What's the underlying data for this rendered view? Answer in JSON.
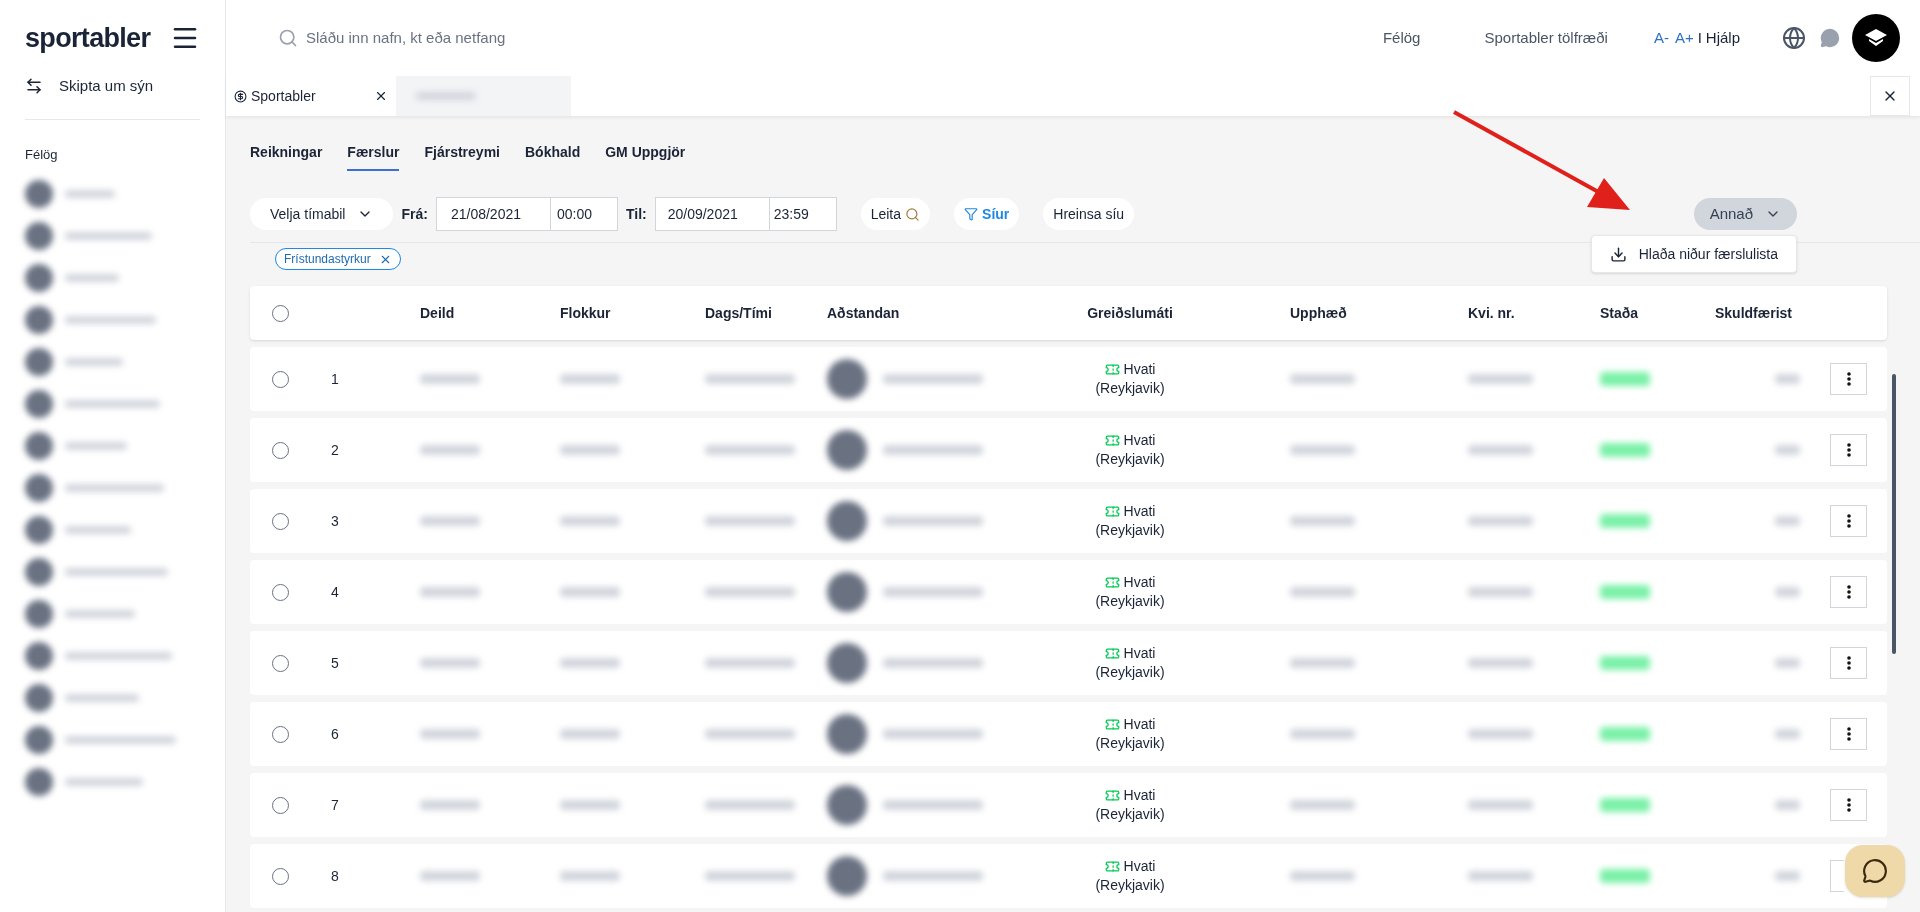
{
  "logo": "sportabler",
  "sidebar": {
    "switch_view": "Skipta um sýn",
    "section_title": "Félög"
  },
  "search": {
    "placeholder": "Sláðu inn nafn, kt eða netfang"
  },
  "top_nav": {
    "links": [
      "Félög",
      "Sportabler tölfræði"
    ],
    "font_smaller": "A-",
    "font_larger": "A+",
    "separator": "I",
    "help": "Hjálp"
  },
  "open_tabs": [
    {
      "label": "Sportabler",
      "selected": true
    }
  ],
  "sub_tabs": [
    {
      "label": "Reikningar",
      "selected": false
    },
    {
      "label": "Færslur",
      "selected": true
    },
    {
      "label": "Fjárstreymi",
      "selected": false
    },
    {
      "label": "Bókhald",
      "selected": false
    },
    {
      "label": "GM Uppgjör",
      "selected": false
    }
  ],
  "filters": {
    "period": "Velja tímabil",
    "from_label": "Frá:",
    "from_date": "21/08/2021",
    "from_time": "00:00",
    "to_label": "Til:",
    "to_date": "20/09/2021",
    "to_time": "23:59",
    "search": "Leita",
    "filters": "Síur",
    "clear": "Hreinsa síu"
  },
  "active_filters": [
    "Frístundastyrkur"
  ],
  "other_menu": {
    "label": "Annað",
    "expanded": true,
    "items": [
      "Hlaða niður færslulista"
    ]
  },
  "table": {
    "columns": [
      "Deild",
      "Flokkur",
      "Dags/Tími",
      "Aðstandan",
      "Greiðslumáti",
      "Upphæð",
      "Kvi. nr.",
      "Staða",
      "Skuldfærist"
    ],
    "header_checked": false,
    "rows": [
      {
        "number": "1",
        "checked": false,
        "payment": "Hvati",
        "payment_region": "(Reykjavik)"
      },
      {
        "number": "2",
        "checked": false,
        "payment": "Hvati",
        "payment_region": "(Reykjavik)"
      },
      {
        "number": "3",
        "checked": false,
        "payment": "Hvati",
        "payment_region": "(Reykjavik)"
      },
      {
        "number": "4",
        "checked": false,
        "payment": "Hvati",
        "payment_region": "(Reykjavik)"
      },
      {
        "number": "5",
        "checked": false,
        "payment": "Hvati",
        "payment_region": "(Reykjavik)"
      },
      {
        "number": "6",
        "checked": false,
        "payment": "Hvati",
        "payment_region": "(Reykjavik)"
      },
      {
        "number": "7",
        "checked": false,
        "payment": "Hvati",
        "payment_region": "(Reykjavik)"
      },
      {
        "number": "8",
        "checked": false,
        "payment": "Hvati",
        "payment_region": "(Reykjavik)"
      }
    ]
  }
}
